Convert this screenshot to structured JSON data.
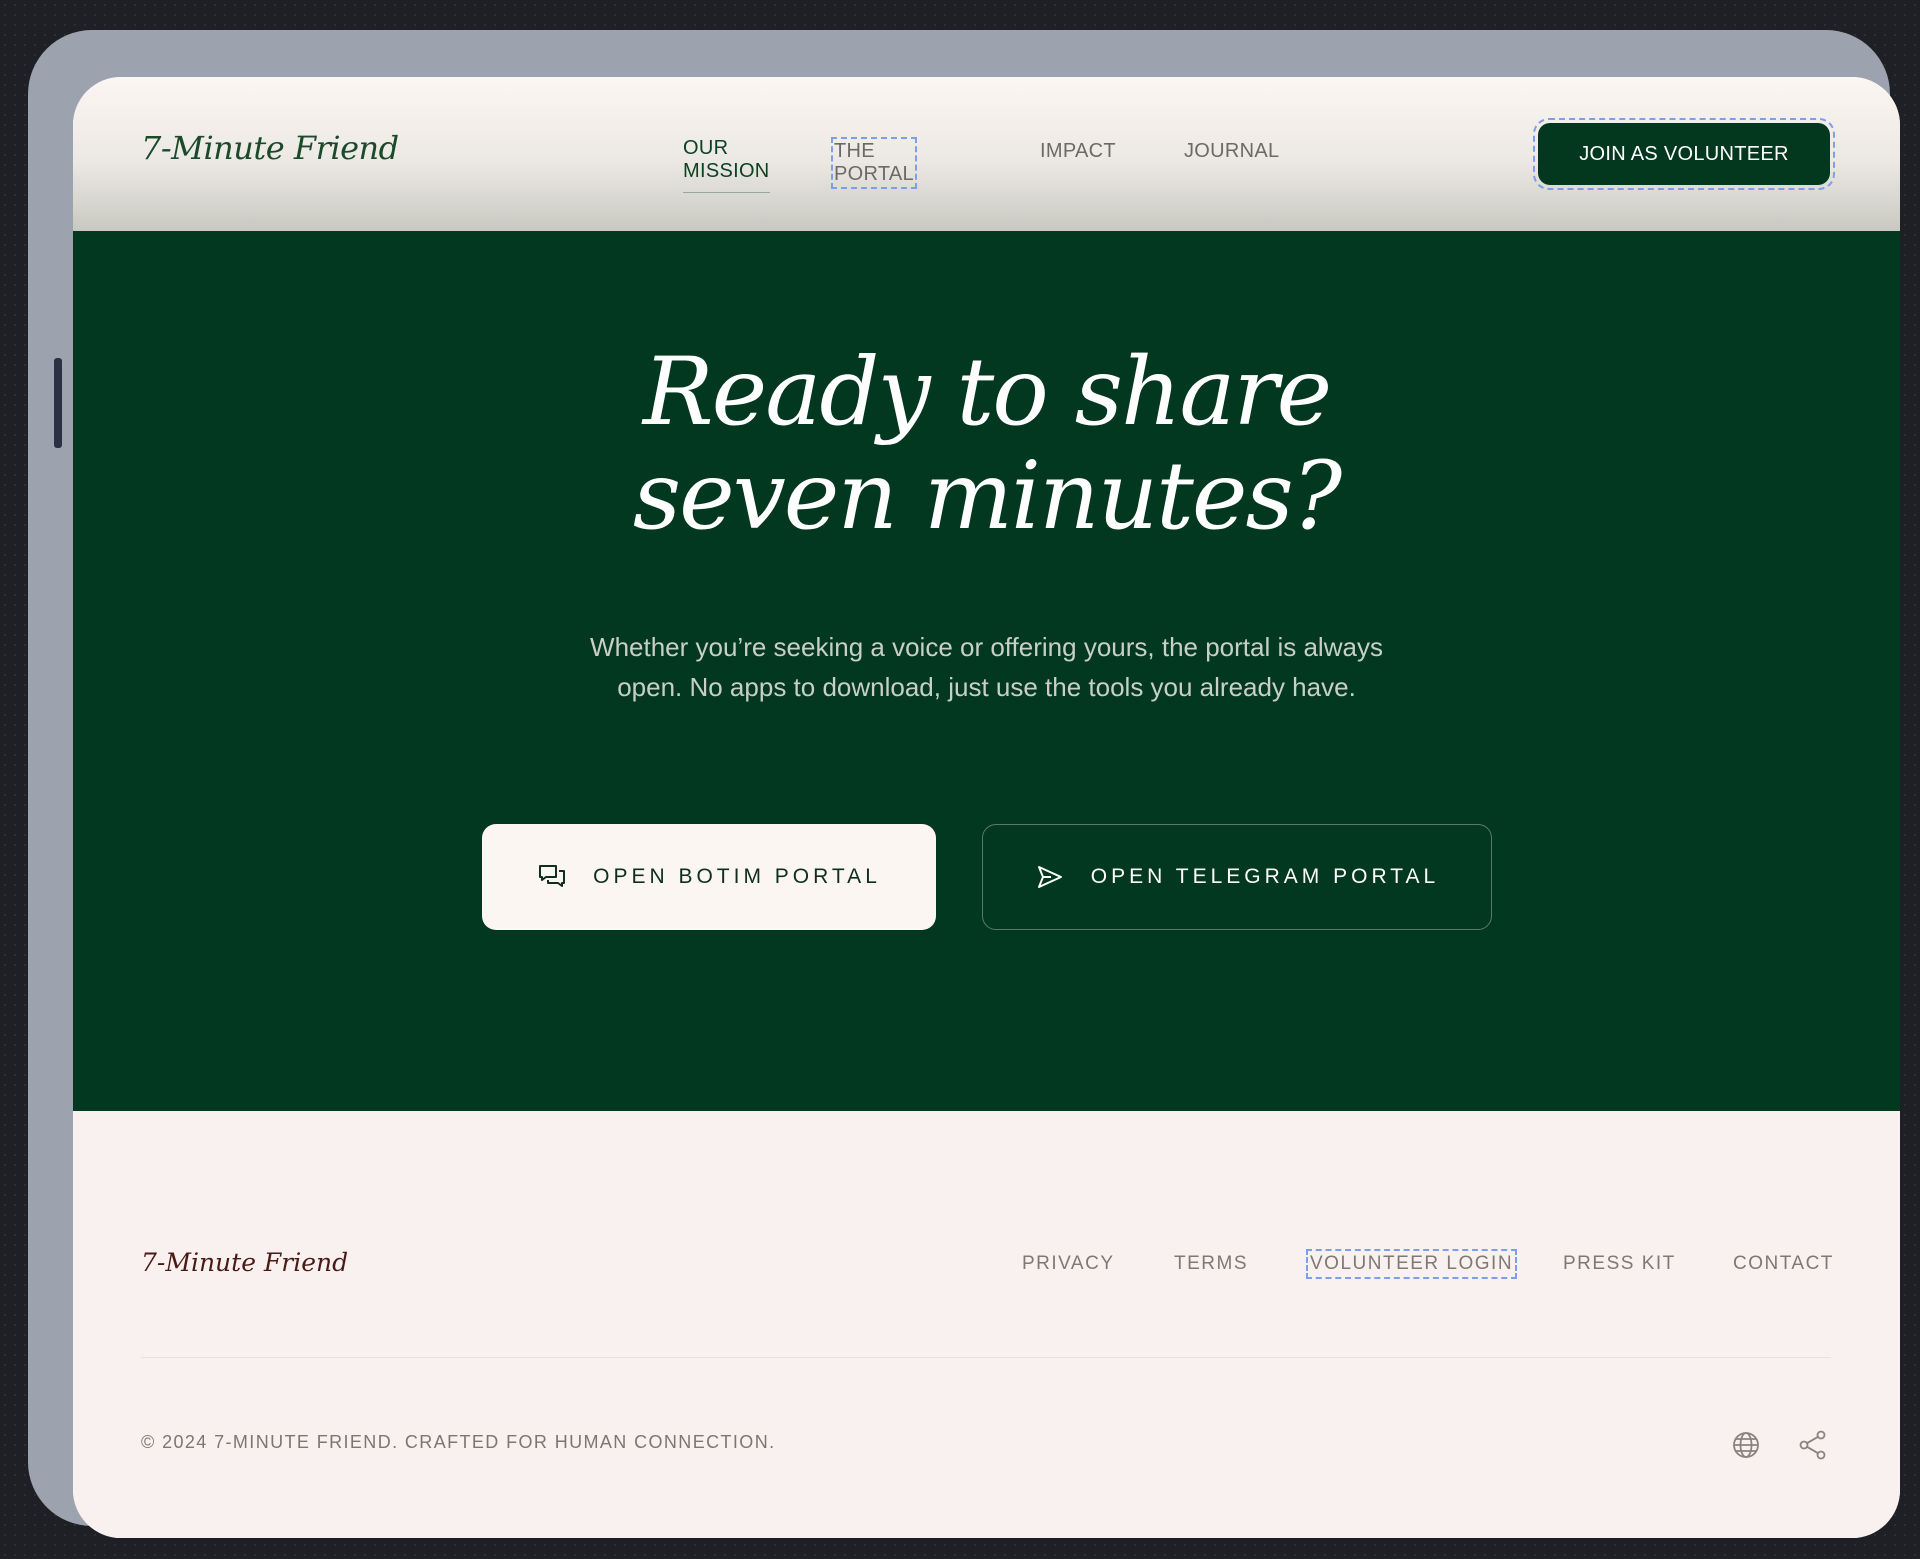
{
  "header": {
    "brand": "7-Minute Friend",
    "nav": [
      {
        "label": "OUR MISSION",
        "active": true
      },
      {
        "label": "THE PORTAL",
        "focused": true
      },
      {
        "label": "IMPACT"
      },
      {
        "label": "JOURNAL"
      }
    ],
    "cta_label": "JOIN AS VOLUNTEER"
  },
  "hero": {
    "title_line1": "Ready to share",
    "title_line2": "seven minutes?",
    "subtitle": "Whether you’re seeking a voice or offering yours, the portal is always open. No apps to download, just use the tools you already have.",
    "buttons": [
      {
        "label": "OPEN BOTIM PORTAL",
        "icon": "chat-bubbles-icon"
      },
      {
        "label": "OPEN TELEGRAM PORTAL",
        "icon": "send-icon"
      }
    ]
  },
  "footer": {
    "brand": "7-Minute Friend",
    "links": [
      "PRIVACY",
      "TERMS",
      "VOLUNTEER LOGIN",
      "PRESS KIT",
      "CONTACT"
    ],
    "copyright": "© 2024 7-MINUTE FRIEND. CRAFTED FOR HUMAN CONNECTION.",
    "icons": [
      "globe-icon",
      "share-icon"
    ]
  },
  "colors": {
    "primary_green": "#023820",
    "cream": "#f8f1ef",
    "focus_outline": "#7d9ee8"
  }
}
